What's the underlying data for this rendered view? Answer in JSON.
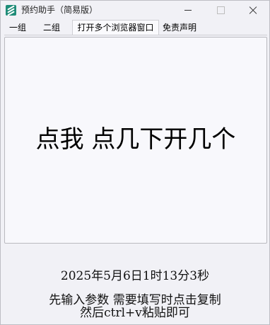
{
  "window": {
    "title": "预约助手（简易版）",
    "icon": "app-logo-icon"
  },
  "tabs": [
    {
      "label": "一组",
      "active": false
    },
    {
      "label": "二组",
      "active": false
    },
    {
      "label": "打开多个浏览器窗口",
      "active": true
    },
    {
      "label": "免责声明",
      "active": false
    }
  ],
  "main": {
    "button_label": "点我  点几下开几个",
    "datetime": "2025年5月6日1时13分3秒",
    "hint_line1": "先输入参数 需要填写时点击复制",
    "hint_line2": "然后ctrl+v粘贴即可"
  },
  "colors": {
    "icon_accent": "#1f8c78",
    "window_bg": "#f1f1f6",
    "panel_bg": "#f8f8fc"
  }
}
